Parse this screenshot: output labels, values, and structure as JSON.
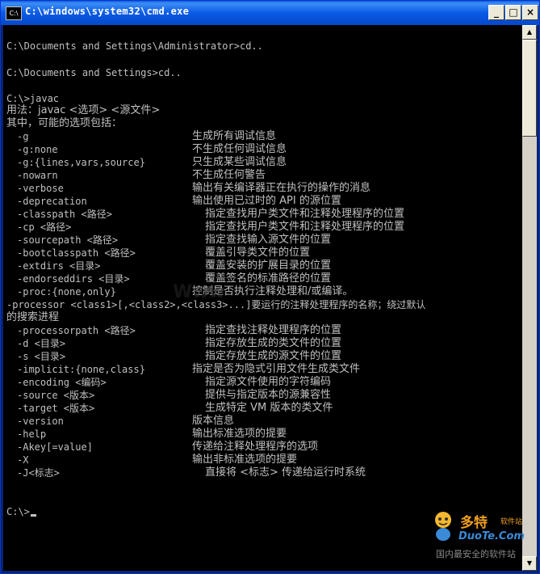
{
  "window": {
    "title": "C:\\windows\\system32\\cmd.exe",
    "icon_label": "C:\\",
    "buttons": {
      "minimize": "_",
      "maximize": "□",
      "close": "×"
    }
  },
  "console": {
    "lines": [
      "C:\\Documents and Settings\\Administrator>cd..",
      "C:\\Documents and Settings>cd..",
      "C:\\>javac",
      "用法：javac <选项> <源文件>",
      "其中，可能的选项包括："
    ],
    "options": [
      {
        "opt": "-g",
        "desc": "生成所有调试信息"
      },
      {
        "opt": "-g:none",
        "desc": "不生成任何调试信息"
      },
      {
        "opt": "-g:{lines,vars,source}",
        "desc": "只生成某些调试信息"
      },
      {
        "opt": "-nowarn",
        "desc": "不生成任何警告"
      },
      {
        "opt": "-verbose",
        "desc": "输出有关编译器正在执行的操作的消息"
      },
      {
        "opt": "-deprecation",
        "desc": "输出使用已过时的 API 的源位置"
      },
      {
        "opt": "-classpath <路径>",
        "desc": "指定查找用户类文件和注释处理程序的位置"
      },
      {
        "opt": "-cp <路径>",
        "desc": "指定查找用户类文件和注释处理程序的位置"
      },
      {
        "opt": "-sourcepath <路径>",
        "desc": "指定查找输入源文件的位置"
      },
      {
        "opt": "-bootclasspath <路径>",
        "desc": "覆盖引导类文件的位置"
      },
      {
        "opt": "-extdirs <目录>",
        "desc": "覆盖安装的扩展目录的位置"
      },
      {
        "opt": "-endorseddirs <目录>",
        "desc": "覆盖签名的标准路径的位置"
      },
      {
        "opt": "-proc:{none,only}",
        "desc": "控制是否执行注释处理和/或编译。"
      }
    ],
    "processor_line1": "-processor <class1>[,<class2>,<class3>...]要运行的注释处理程序的名称；绕过默认",
    "processor_line2": "的搜索进程",
    "options2": [
      {
        "opt": "-processorpath <路径>",
        "desc": "指定查找注释处理程序的位置"
      },
      {
        "opt": "-d <目录>",
        "desc": "指定存放生成的类文件的位置"
      },
      {
        "opt": "-s <目录>",
        "desc": "指定存放生成的源文件的位置"
      },
      {
        "opt": "-implicit:{none,class}",
        "desc": "指定是否为隐式引用文件生成类文件"
      },
      {
        "opt": "-encoding <编码>",
        "desc": "指定源文件使用的字符编码"
      },
      {
        "opt": "-source <版本>",
        "desc": "提供与指定版本的源兼容性"
      },
      {
        "opt": "-target <版本>",
        "desc": "生成特定 VM 版本的类文件"
      },
      {
        "opt": "-version",
        "desc": "版本信息"
      },
      {
        "opt": "-help",
        "desc": "输出标准选项的提要"
      },
      {
        "opt": "-Akey[=value]",
        "desc": "传递给注释处理程序的选项"
      },
      {
        "opt": "-X",
        "desc": "输出非标准选项的提要"
      },
      {
        "opt": "-J<标志>",
        "desc": "直接将 <标志> 传递给运行时系统"
      }
    ],
    "prompt": "C:\\>"
  },
  "scrollbar": {
    "up_arrow": "▲",
    "down_arrow": "▼"
  },
  "watermark": {
    "brand_cn": "多特",
    "brand_cn_small": "软件站",
    "brand_en": "DuoTe.Com",
    "slogan": "国内最安全的软件站",
    "center_text": "Www"
  }
}
